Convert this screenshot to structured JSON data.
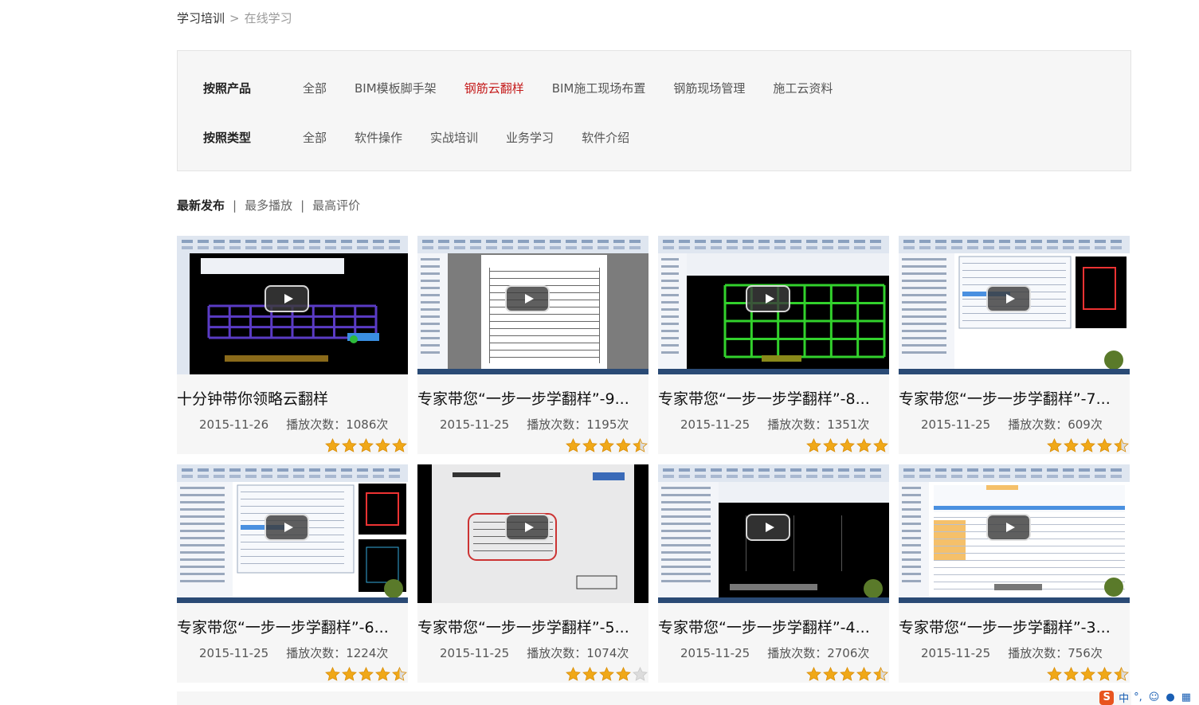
{
  "breadcrumb": {
    "root": "学习培训",
    "separator": ">",
    "current": "在线学习"
  },
  "filters": {
    "product": {
      "label": "按照产品",
      "options": [
        "全部",
        "BIM模板脚手架",
        "钢筋云翻样",
        "BIM施工现场布置",
        "钢筋现场管理",
        "施工云资料"
      ],
      "active_index": 2
    },
    "type": {
      "label": "按照类型",
      "options": [
        "全部",
        "软件操作",
        "实战培训",
        "业务学习",
        "软件介绍"
      ]
    }
  },
  "sort": {
    "separator": "|",
    "options": [
      "最新发布",
      "最多播放",
      "最高评价"
    ],
    "active_index": 0
  },
  "colors": {
    "accent": "#c41a1a",
    "star": "#f0a818",
    "panel_bg": "#f6f6f6"
  },
  "videos": [
    {
      "title": "十分钟带你领略云翻样",
      "date": "2015-11-26",
      "plays": "播放次数：1086次",
      "rating": 5,
      "theme": "cad-blue"
    },
    {
      "title": "专家带您“一步一步学翻样”-9...",
      "date": "2015-11-25",
      "plays": "播放次数：1195次",
      "rating": 4.5,
      "theme": "document"
    },
    {
      "title": "专家带您“一步一步学翻样”-8...",
      "date": "2015-11-25",
      "plays": "播放次数：1351次",
      "rating": 5,
      "theme": "cad-green"
    },
    {
      "title": "专家带您“一步一步学翻样”-7...",
      "date": "2015-11-25",
      "plays": "播放次数：609次",
      "rating": 4.5,
      "theme": "software"
    },
    {
      "title": "专家带您“一步一步学翻样”-6...",
      "date": "2015-11-25",
      "plays": "播放次数：1224次",
      "rating": 4.5,
      "theme": "software-red"
    },
    {
      "title": "专家带您“一步一步学翻样”-5...",
      "date": "2015-11-25",
      "plays": "播放次数：1074次",
      "rating": 4,
      "theme": "whiteboard"
    },
    {
      "title": "专家带您“一步一步学翻样”-4...",
      "date": "2015-11-25",
      "plays": "播放次数：2706次",
      "rating": 4.5,
      "theme": "cad-black"
    },
    {
      "title": "专家带您“一步一步学翻样”-3...",
      "date": "2015-11-25",
      "plays": "播放次数：756次",
      "rating": 4.5,
      "theme": "spreadsheet"
    }
  ],
  "ime": {
    "logo": "S",
    "text": "中"
  }
}
